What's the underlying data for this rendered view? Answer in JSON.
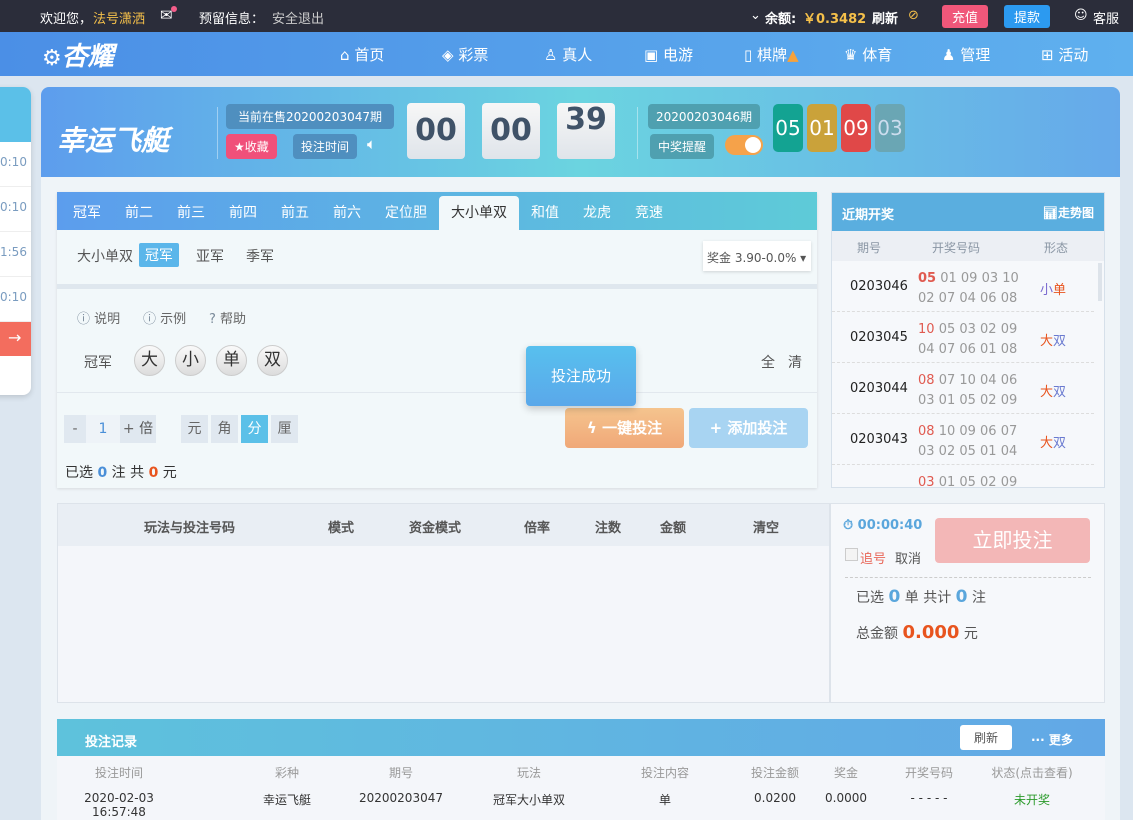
{
  "topbar": {
    "welcome": "欢迎您，",
    "username": "法号潇洒",
    "reserved_label": "预留信息：",
    "logout": "安全退出",
    "balance_label": "余额:",
    "balance": "￥0.3482",
    "refresh": "刷新",
    "deposit": "充值",
    "withdraw": "提款",
    "service": "客服"
  },
  "nav": {
    "logo": "杏耀",
    "items": [
      "首页",
      "彩票",
      "真人",
      "电游",
      "棋牌",
      "体育",
      "管理",
      "活动"
    ]
  },
  "sidepanel": {
    "times": [
      "0:10",
      "0:10",
      "1:56",
      "0:10"
    ]
  },
  "game": {
    "name": "幸运飞艇",
    "current_issue": "当前在售20200203047期",
    "favorite": "★收藏",
    "bet_time": "投注时间",
    "countdown": [
      "00",
      "00",
      "39"
    ],
    "last_issue": "20200203046期",
    "win_alert": "中奖提醒",
    "last_balls": [
      "05",
      "01",
      "09",
      "03"
    ]
  },
  "bet": {
    "tabs": [
      "冠军",
      "前二",
      "前三",
      "前四",
      "前五",
      "前六",
      "定位胆",
      "大小单双",
      "和值",
      "龙虎",
      "竞速"
    ],
    "active_tab": "大小单双",
    "subtabs": [
      "大小单双",
      "冠军",
      "亚军",
      "季军"
    ],
    "prize": "奖金 3.90-0.0%",
    "help": [
      "说明",
      "示例",
      "帮助"
    ],
    "row_label": "冠军",
    "options": [
      "大",
      "小",
      "单",
      "双"
    ],
    "all": "全",
    "clear": "清",
    "toast": "投注成功",
    "minus": "-",
    "multiplier": "1",
    "plus": "+",
    "times_label": "倍",
    "units": [
      "元",
      "角",
      "分",
      "厘"
    ],
    "quick_bet": "一键投注",
    "add_bet": "添加投注",
    "summary": {
      "pre": "已选",
      "count": "0",
      "mid": "注  共",
      "amount": "0",
      "post": "元"
    }
  },
  "recent": {
    "title": "近期开奖",
    "trend": "走势图",
    "headers": [
      "期号",
      "开奖号码",
      "形态"
    ],
    "rows": [
      {
        "issue": "0203046",
        "first": "05",
        "rest": "01 09 03 10",
        "line2": "02 07 04 06 08",
        "a": "小",
        "b": "单"
      },
      {
        "issue": "0203045",
        "first": "10",
        "rest": "05 03 02 09",
        "line2": "04 07 06 01 08",
        "a": "大",
        "b": "双"
      },
      {
        "issue": "0203044",
        "first": "08",
        "rest": "07 10 04 06",
        "line2": "03 01 05 02 09",
        "a": "大",
        "b": "双"
      },
      {
        "issue": "0203043",
        "first": "08",
        "rest": "10 09 06 07",
        "line2": "03 02 05 01 04",
        "a": "大",
        "b": "双"
      },
      {
        "issue": "",
        "first": "03",
        "rest": "01 05 02 09",
        "line2": "",
        "a": "",
        "b": ""
      }
    ]
  },
  "cart": {
    "headers": [
      "玩法与投注号码",
      "模式",
      "资金模式",
      "倍率",
      "注数",
      "金额",
      "清空"
    ]
  },
  "checkout": {
    "timer": "00:00:40",
    "chase": "追号",
    "cancel": "取消",
    "submit": "立即投注",
    "sel_pre": "已选",
    "orders": "0",
    "sel_mid": "单 共计",
    "bets": "0",
    "sel_post": "注",
    "total_label": "总金额",
    "total": "0.000",
    "total_unit": "元"
  },
  "records": {
    "title": "投注记录",
    "refresh": "刷新",
    "more": "··· 更多",
    "headers": [
      "投注时间",
      "彩种",
      "期号",
      "玩法",
      "投注内容",
      "投注金额",
      "奖金",
      "开奖号码",
      "状态(点击查看)"
    ],
    "rows": [
      [
        "2020-02-03 16:57:48",
        "幸运飞艇",
        "20200203047",
        "冠军大小单双",
        "单",
        "0.0200",
        "0.0000",
        "- - - - -",
        "未开奖"
      ]
    ]
  }
}
